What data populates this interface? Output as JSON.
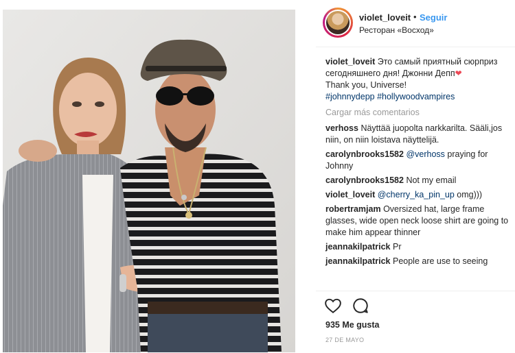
{
  "header": {
    "username": "violet_loveit",
    "separator": "•",
    "follow_label": "Seguir",
    "location": "Ресторан «Восход»"
  },
  "caption": {
    "username": "violet_loveit",
    "text": "Это самый приятный сюрприз сегодняшнего дня! Джонни Депп",
    "heart": "❤",
    "line2": "Thank you, Universe!",
    "hashtags": "#johnnydepp #hollywoodvampires"
  },
  "load_more_label": "Cargar más comentarios",
  "comments": [
    {
      "user": "verhoss",
      "mention": "",
      "text": "Näyttää juopolta narkkarilta. Sääli,jos niin, on niin loistava näyttelijä."
    },
    {
      "user": "carolynbrooks1582",
      "mention": "@verhoss",
      "text": "praying for Johnny"
    },
    {
      "user": "carolynbrooks1582",
      "mention": "",
      "text": "Not my email"
    },
    {
      "user": "violet_loveit",
      "mention": "@cherry_ka_pin_up",
      "text": "omg)))"
    },
    {
      "user": "robertramjam",
      "mention": "",
      "text": "Oversized hat, large frame glasses, wide open neck loose shirt are going to make him appear thinner"
    },
    {
      "user": "jeannakilpatrick",
      "mention": "",
      "text": "Pr"
    },
    {
      "user": "jeannakilpatrick",
      "mention": "",
      "text": "People are use to seeing"
    }
  ],
  "actions": {
    "like_icon": "heart-outline-icon",
    "comment_icon": "speech-bubble-icon"
  },
  "likes": "935 Me gusta",
  "date": "27 DE MAYO",
  "colors": {
    "link": "#3897f0",
    "hashtag": "#003569",
    "muted": "#999999",
    "text": "#262626"
  }
}
